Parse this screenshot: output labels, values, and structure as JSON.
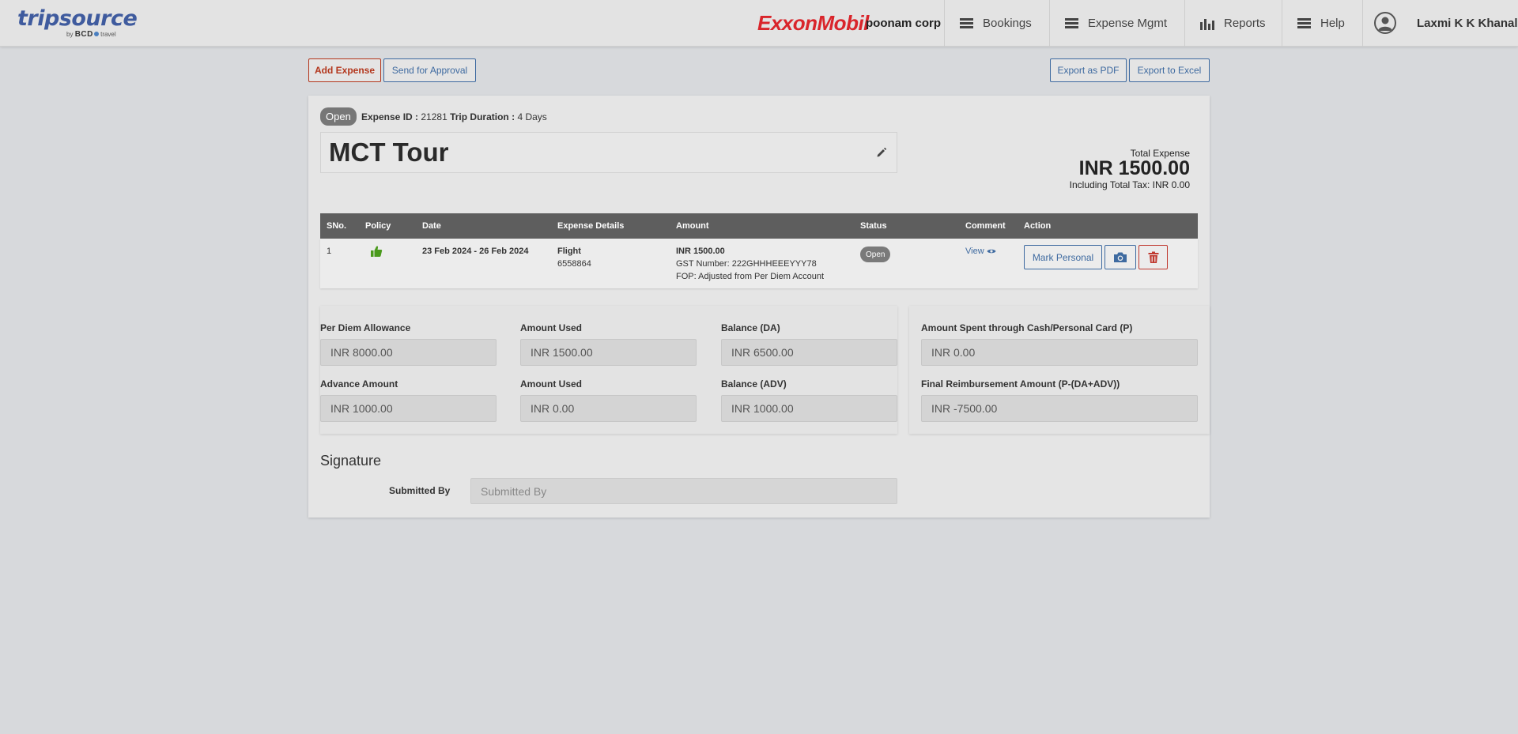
{
  "header": {
    "logo_primary": "tripsource",
    "logo_sub_prefix": "by",
    "logo_sub_brand": "BCD",
    "logo_sub_suffix": "travel",
    "brand": "ExxonMobil",
    "company": "poonam corp",
    "nav": [
      {
        "label": "Bookings",
        "icon": "menu-icon"
      },
      {
        "label": "Expense Mgmt",
        "icon": "menu-icon"
      },
      {
        "label": "Reports",
        "icon": "bar-chart-icon"
      },
      {
        "label": "Help",
        "icon": "menu-icon"
      }
    ],
    "user_name": "Laxmi K K Khanal"
  },
  "toolbar": {
    "add_expense": "Add Expense",
    "send_for_approval": "Send for Approval",
    "export_pdf": "Export as PDF",
    "export_excel": "Export to Excel"
  },
  "expense": {
    "status": "Open",
    "expense_id_label": "Expense ID :",
    "expense_id": "21281",
    "trip_duration_label": "Trip Duration :",
    "trip_duration": "4 Days",
    "title": "MCT Tour",
    "total_label": "Total Expense",
    "total_amount": "INR 1500.00",
    "total_tax": "Including Total Tax: INR 0.00"
  },
  "table": {
    "columns": [
      "SNo.",
      "Policy",
      "Date",
      "Expense Details",
      "Amount",
      "Status",
      "Comment",
      "Action"
    ],
    "rows": [
      {
        "sno": "1",
        "policy_icon": "thumbs-up-icon",
        "date": "23 Feb 2024 - 26 Feb 2024",
        "detail_type": "Flight",
        "detail_ref": "6558864",
        "amount": "INR 1500.00",
        "gst": "GST Number: 222GHHHEEEYYY78",
        "fop": "FOP: Adjusted from Per Diem Account",
        "status": "Open",
        "comment": "View",
        "mark_personal": "Mark Personal"
      }
    ]
  },
  "summary": {
    "per_diem_label": "Per Diem Allowance",
    "per_diem_value": "INR 8000.00",
    "amount_used_1_label": "Amount Used",
    "amount_used_1_value": "INR 1500.00",
    "balance_da_label": "Balance (DA)",
    "balance_da_value": "INR 6500.00",
    "advance_label": "Advance Amount",
    "advance_value": "INR 1000.00",
    "amount_used_2_label": "Amount Used",
    "amount_used_2_value": "INR 0.00",
    "balance_adv_label": "Balance (ADV)",
    "balance_adv_value": "INR 1000.00",
    "cash_spent_label": "Amount Spent through Cash/Personal Card (P)",
    "cash_spent_value": "INR 0.00",
    "final_reimb_label": "Final Reimbursement Amount (P-(DA+ADV))",
    "final_reimb_value": "INR -7500.00"
  },
  "signature": {
    "title": "Signature",
    "submitted_by_label": "Submitted By",
    "submitted_by_placeholder": "Submitted By"
  },
  "colors": {
    "accent_blue": "#3e6aa0",
    "danger_red": "#c03a30",
    "brand_red": "#d9252b",
    "header_bg": "#e3e3e3",
    "table_head": "#5e5e5e",
    "policy_green": "#4a9a1c"
  }
}
